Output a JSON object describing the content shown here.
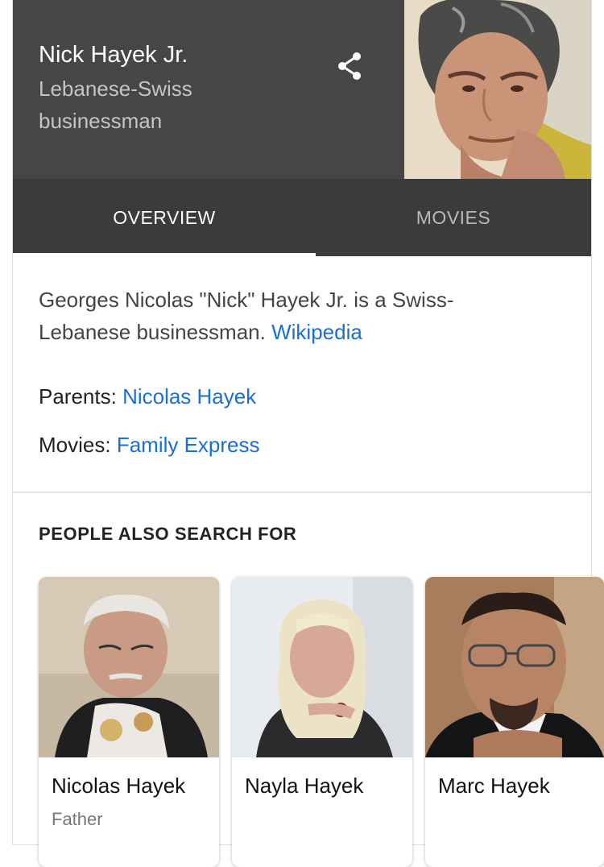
{
  "entity": {
    "name": "Nick Hayek Jr.",
    "subtitle": "Lebanese-Swiss businessman"
  },
  "tabs": [
    {
      "label": "OVERVIEW",
      "active": true
    },
    {
      "label": "MOVIES",
      "active": false
    }
  ],
  "description": {
    "text": "Georges Nicolas \"Nick\" Hayek Jr. is a Swiss-Lebanese businessman.",
    "source_link": "Wikipedia"
  },
  "facts": {
    "parents_label": "Parents:",
    "parents_value": "Nicolas Hayek",
    "movies_label": "Movies:",
    "movies_value": "Family Express"
  },
  "people_also_search": {
    "title": "PEOPLE ALSO SEARCH FOR",
    "people": [
      {
        "name": "Nicolas Hayek",
        "relation": "Father"
      },
      {
        "name": "Nayla Hayek",
        "relation": ""
      },
      {
        "name": "Marc Hayek",
        "relation": ""
      }
    ]
  },
  "colors": {
    "header_bg": "#464646",
    "tab_bg": "#3b3b3b",
    "link": "#1a6fd1"
  },
  "icons": {
    "share": "share-icon"
  }
}
